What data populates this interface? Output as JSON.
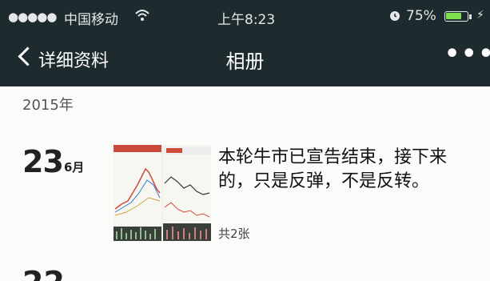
{
  "status_bar": {
    "signal_dots": "●●●●●",
    "carrier": "中国移动",
    "wifi_icon": "wifi-icon",
    "time": "上午8:23",
    "alarm_icon": "alarm-icon",
    "battery_percent": "75%",
    "battery_level": 0.75,
    "battery_color": "#7ee04c",
    "charging_icon": "⚡"
  },
  "nav": {
    "back_label": "详细资料",
    "title": "相册",
    "more": "•••"
  },
  "album": {
    "year": "2015年",
    "posts": [
      {
        "day": "23",
        "month": "6月",
        "text": "本轮牛市已宣告结束，接下来的，只是反弹，不是反转。",
        "count": "共2张"
      }
    ],
    "next_day_partial": "22"
  }
}
